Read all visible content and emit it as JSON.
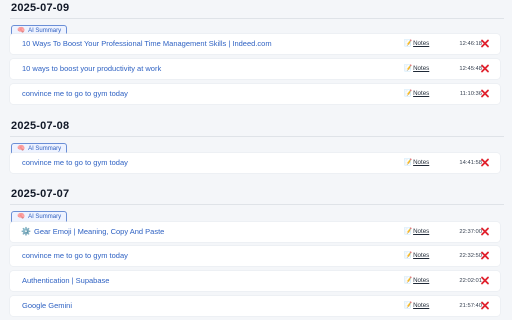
{
  "ai_summary_label": "AI Summary",
  "notes_label": "Notes",
  "groups": [
    {
      "date": "2025-07-09",
      "items": [
        {
          "title": "10 Ways To Boost Your Professional Time Management Skills | Indeed.com",
          "time": "12:46:18"
        },
        {
          "title": "10 ways to boost your productivity at work",
          "time": "12:45:48"
        },
        {
          "title": "convince me to go to gym today",
          "time": "11:10:36"
        }
      ]
    },
    {
      "date": "2025-07-08",
      "items": [
        {
          "title": "convince me to go to gym today",
          "time": "14:41:58"
        }
      ]
    },
    {
      "date": "2025-07-07",
      "items": [
        {
          "title": "Gear Emoji | Meaning, Copy And Paste",
          "time": "22:37:00",
          "favicon": "⚙️"
        },
        {
          "title": "convince me to go to gym today",
          "time": "22:32:50"
        },
        {
          "title": "Authentication | Supabase",
          "time": "22:02:01"
        },
        {
          "title": "Google Gemini",
          "time": "21:57:40"
        }
      ]
    }
  ],
  "colors": {
    "link": "#2f62c3",
    "delete": "#e0202c",
    "ai_button_border": "#6b8fd6"
  }
}
